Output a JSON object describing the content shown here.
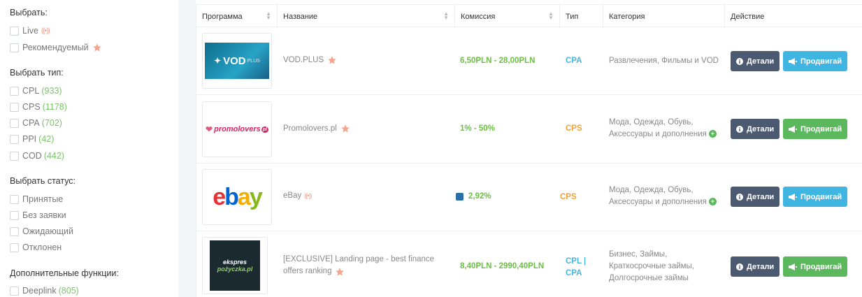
{
  "sidebar": {
    "select_title": "Выбрать:",
    "select_items": [
      {
        "label": "Live"
      },
      {
        "label": "Рекомендуемый"
      }
    ],
    "type_title": "Выбрать тип:",
    "type_items": [
      {
        "label": "CPL",
        "count": "(933)"
      },
      {
        "label": "CPS",
        "count": "(1178)"
      },
      {
        "label": "CPA",
        "count": "(702)"
      },
      {
        "label": "PPI",
        "count": "(42)"
      },
      {
        "label": "COD",
        "count": "(442)"
      }
    ],
    "status_title": "Выбрать статус:",
    "status_items": [
      {
        "label": "Принятые"
      },
      {
        "label": "Без заявки"
      },
      {
        "label": "Ожидающий"
      },
      {
        "label": "Отклонен"
      }
    ],
    "extra_title": "Дополнительные функции:",
    "extra_items": [
      {
        "label": "Deeplink",
        "count": "(805)"
      }
    ]
  },
  "table": {
    "headers": {
      "program": "Программа",
      "name": "Название",
      "commission": "Комиссия",
      "type": "Тип",
      "category": "Категория",
      "action": "Действие"
    },
    "rows": [
      {
        "logo_text": "VOD",
        "logo_sub": "PLUS",
        "name": "VOD.PLUS",
        "commission": "6,50PLN - 28,00PLN",
        "type": "CPA",
        "category": "Развлечения, Фильмы и VOD",
        "details": "Детали",
        "promote": "Продвигай"
      },
      {
        "logo_text": "promolovers",
        "logo_sub": "pl",
        "name": "Promolovers.pl",
        "commission": "1% - 50%",
        "type": "CPS",
        "category_line1": "Мода, Одежда, Обувь,",
        "category_line2": "Аксессуары и дополнения",
        "details": "Детали",
        "promote": "Продвигай"
      },
      {
        "logo_text": "ebay",
        "name": "eBay",
        "commission": "2,92%",
        "type": "CPS",
        "category_line1": "Мода, Одежда, Обувь,",
        "category_line2": "Аксессуары и дополнения",
        "details": "Детали",
        "promote": "Продвигай"
      },
      {
        "logo_text_1": "ekspres",
        "logo_text_2": "pożyczka.pl",
        "name_line1": "[EXCLUSIVE] Landing page - best finance",
        "name_line2": "offers ranking",
        "commission": "8,40PLN - 2990,40PLN",
        "type_line1": "CPL |",
        "type_line2": "CPA",
        "category_line1": "Бизнес, Займы,",
        "category_line2": "Краткосрочные займы,",
        "category_line3": "Долгосрочные займы",
        "details": "Детали",
        "promote": "Продвигай"
      }
    ]
  },
  "colors": {
    "details_button": "#4c5a71",
    "promote_blue": "#3fb5e2",
    "promote_green": "#5cb85c",
    "commission": "#6cbe45",
    "type_cpa": "#46b8da",
    "type_cps": "#f0a23b",
    "count": "#7cc36b"
  }
}
